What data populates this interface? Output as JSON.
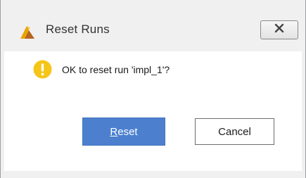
{
  "window": {
    "title": "Reset Runs",
    "icon": "vivado-logo-icon",
    "close_icon": "close-icon"
  },
  "dialog": {
    "icon": "warning-icon",
    "message": "OK to reset run 'impl_1'?"
  },
  "buttons": {
    "reset": {
      "label_mnemonic": "R",
      "label_rest": "eset"
    },
    "cancel": {
      "label": "Cancel"
    }
  },
  "colors": {
    "primary_button": "#4c80cf",
    "warning": "#f5c518"
  }
}
